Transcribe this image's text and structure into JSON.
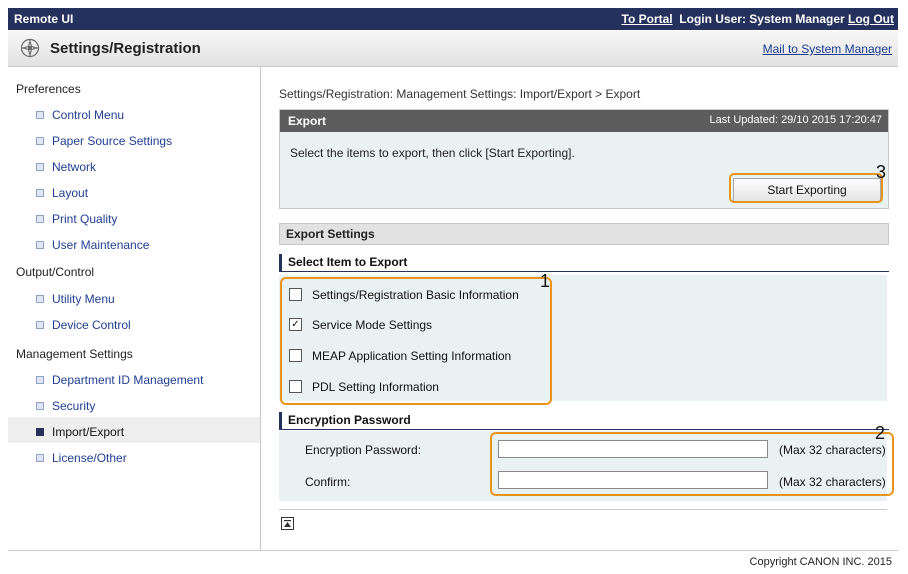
{
  "topbar": {
    "app_name": "Remote UI",
    "portal_link": "To Portal",
    "login_label": "Login User: System Manager",
    "logout_link": "Log Out"
  },
  "header": {
    "title": "Settings/Registration",
    "mail_link": "Mail to System Manager"
  },
  "sidebar": {
    "groups": [
      {
        "label": "Preferences",
        "items": [
          "Control Menu",
          "Paper Source Settings",
          "Network",
          "Layout",
          "Print Quality",
          "User Maintenance"
        ]
      },
      {
        "label": "Output/Control",
        "items": [
          "Utility Menu",
          "Device Control"
        ]
      },
      {
        "label": "Management Settings",
        "items": [
          "Department ID Management",
          "Security",
          "Import/Export",
          "License/Other"
        ]
      }
    ],
    "active_item": "Import/Export"
  },
  "main": {
    "breadcrumb": "Settings/Registration: Management Settings: Import/Export > Export",
    "export_title": "Export",
    "last_updated": "Last Updated: 29/10 2015 17:20:47",
    "description": "Select the items to export, then click [Start Exporting].",
    "start_button": "Start Exporting",
    "settings_bar": "Export Settings",
    "select_section": "Select Item to Export",
    "items": [
      {
        "label": "Settings/Registration Basic Information",
        "checked": false
      },
      {
        "label": "Service Mode Settings",
        "checked": true
      },
      {
        "label": "MEAP Application Setting Information",
        "checked": false
      },
      {
        "label": "PDL Setting Information",
        "checked": false
      }
    ],
    "encryption_section": "Encryption Password",
    "password_label": "Encryption Password:",
    "confirm_label": "Confirm:",
    "max_hint": "(Max 32 characters)",
    "password_value": "",
    "confirm_value": ""
  },
  "annotations": [
    "1",
    "2",
    "3"
  ],
  "footer": {
    "copyright": "Copyright CANON INC. 2015"
  },
  "colors": {
    "topbar": "#23315c",
    "highlight": "#e8941a",
    "panel": "#e9f1f2",
    "link": "#1f3e92"
  }
}
